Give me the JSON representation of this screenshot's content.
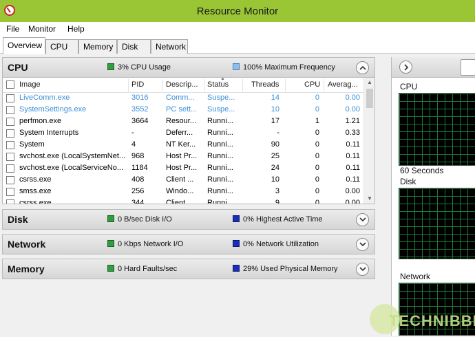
{
  "window": {
    "title": "Resource Monitor"
  },
  "menu": [
    "File",
    "Monitor",
    "Help"
  ],
  "tabs": [
    "Overview",
    "CPU",
    "Memory",
    "Disk",
    "Network"
  ],
  "active_tab": "Overview",
  "cpu": {
    "title": "CPU",
    "stat1": "3% CPU Usage",
    "stat2": "100% Maximum Frequency",
    "columns": [
      "Image",
      "PID",
      "Descrip...",
      "Status",
      "Threads",
      "CPU",
      "Averag..."
    ],
    "rows": [
      {
        "image": "LiveComm.exe",
        "pid": "3016",
        "desc": "Comm...",
        "status": "Suspe...",
        "threads": "14",
        "cpu": "0",
        "avg": "0.00",
        "suspended": true
      },
      {
        "image": "SystemSettings.exe",
        "pid": "3552",
        "desc": "PC sett...",
        "status": "Suspe...",
        "threads": "10",
        "cpu": "0",
        "avg": "0.00",
        "suspended": true
      },
      {
        "image": "perfmon.exe",
        "pid": "3664",
        "desc": "Resour...",
        "status": "Runni...",
        "threads": "17",
        "cpu": "1",
        "avg": "1.21",
        "suspended": false
      },
      {
        "image": "System Interrupts",
        "pid": "-",
        "desc": "Deferr...",
        "status": "Runni...",
        "threads": "-",
        "cpu": "0",
        "avg": "0.33",
        "suspended": false
      },
      {
        "image": "System",
        "pid": "4",
        "desc": "NT Ker...",
        "status": "Runni...",
        "threads": "90",
        "cpu": "0",
        "avg": "0.11",
        "suspended": false
      },
      {
        "image": "svchost.exe (LocalSystemNet...",
        "pid": "968",
        "desc": "Host Pr...",
        "status": "Runni...",
        "threads": "25",
        "cpu": "0",
        "avg": "0.11",
        "suspended": false
      },
      {
        "image": "svchost.exe (LocalServiceNo...",
        "pid": "1184",
        "desc": "Host Pr...",
        "status": "Runni...",
        "threads": "24",
        "cpu": "0",
        "avg": "0.11",
        "suspended": false
      },
      {
        "image": "csrss.exe",
        "pid": "408",
        "desc": "Client ...",
        "status": "Runni...",
        "threads": "10",
        "cpu": "0",
        "avg": "0.11",
        "suspended": false
      },
      {
        "image": "smss.exe",
        "pid": "256",
        "desc": "Windo...",
        "status": "Runni...",
        "threads": "3",
        "cpu": "0",
        "avg": "0.00",
        "suspended": false
      },
      {
        "image": "csrss.exe",
        "pid": "344",
        "desc": "Client ...",
        "status": "Runni...",
        "threads": "9",
        "cpu": "0",
        "avg": "0.00",
        "suspended": false
      }
    ]
  },
  "disk": {
    "title": "Disk",
    "stat1": "0 B/sec Disk I/O",
    "stat2": "0% Highest Active Time"
  },
  "network": {
    "title": "Network",
    "stat1": "0 Kbps Network I/O",
    "stat2": "0% Network Utilization"
  },
  "memory": {
    "title": "Memory",
    "stat1": "0 Hard Faults/sec",
    "stat2": "29% Used Physical Memory"
  },
  "right_pane": {
    "cpu_label": "CPU",
    "seconds_label": "60 Seconds",
    "disk_label": "Disk",
    "network_label": "Network"
  },
  "watermark": "TECHNIBBLE",
  "colors": {
    "titlebar": "#9ac635",
    "suspended_text": "#3b8fd8",
    "graph_grid": "#1e7a35"
  }
}
